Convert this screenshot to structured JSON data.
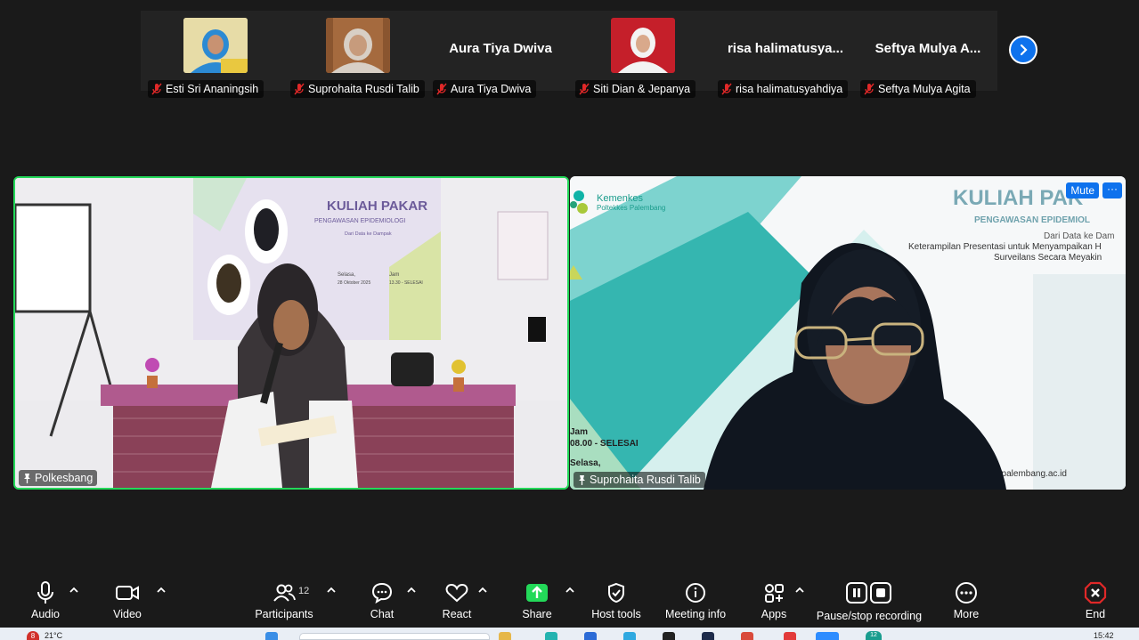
{
  "participants_strip": {
    "tiles": [
      {
        "name": "Esti Sri Ananingsih",
        "big_name": "",
        "muted": true
      },
      {
        "name": "Suprohaita Rusdi Talib",
        "big_name": "",
        "muted": true
      },
      {
        "name": "Aura Tiya Dwiva",
        "big_name": "Aura Tiya Dwiva",
        "muted": true
      },
      {
        "name": "Siti Dian & Jepanya",
        "big_name": "",
        "muted": true
      },
      {
        "name": "risa halimatusyahdiya",
        "big_name": "risa  halimatusya...",
        "muted": true
      },
      {
        "name": "Seftya Mulya Agita",
        "big_name": "Seftya  Mulya  A...",
        "muted": true
      }
    ],
    "next_icon": "chevron-right-icon"
  },
  "videos": [
    {
      "name": "Polkesbang",
      "banner_title": "KULIAH PAKAR",
      "banner_subtitle": "PENGAWASAN EPIDEMIOLOGI",
      "banner_line1": "Dari Data ke Dampak",
      "banner_day": "Selasa,",
      "banner_date": "28 Oktober 2025",
      "banner_time_label": "Jam",
      "banner_time": "13.30 - SELESAI"
    },
    {
      "name": "Suprohaita Rusdi Talib",
      "mute_label": "Mute",
      "more_label": "···",
      "logo_top": "Kemenkes",
      "logo_bottom": "Poltekkes Palembang",
      "bg_title": "KULIAH PAK",
      "bg_subtitle": "PENGAWASAN EPIDEMIOL",
      "bg_line1": "Dari Data ke Dam",
      "bg_line2": "Keterampilan Presentasi untuk Menyampaikan H",
      "bg_line3": "Surveilans Secara Meyakin",
      "bg_time_label": "Jam",
      "bg_time": "08.00 - SELESAI",
      "bg_day": "Selasa,",
      "bg_url": "espalembang.ac.id"
    }
  ],
  "toolbar": {
    "audio": "Audio",
    "video": "Video",
    "participants": "Participants",
    "participants_count": "12",
    "chat": "Chat",
    "react": "React",
    "share": "Share",
    "host_tools": "Host tools",
    "meeting_info": "Meeting info",
    "apps": "Apps",
    "recording": "Pause/stop recording",
    "more": "More",
    "end": "End"
  },
  "colors": {
    "accent": "#0e72ed",
    "active_speaker": "#23d959",
    "share_green": "#23d959",
    "end_red": "#e02828",
    "mute_red": "#e02828"
  },
  "taskbar": {
    "weather": "21°C",
    "notification_badge": "8",
    "clock": "15:42",
    "app_badge": "12"
  }
}
